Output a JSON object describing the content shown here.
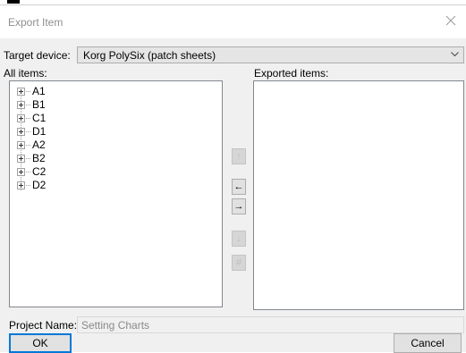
{
  "dialog": {
    "title": "Export Item",
    "close_icon": "close-icon"
  },
  "target_device": {
    "label": "Target device:",
    "value": "Korg PolySix (patch sheets)",
    "icon": "chevron-down-icon"
  },
  "all_items": {
    "label": "All items:",
    "items": [
      "A1",
      "B1",
      "C1",
      "D1",
      "A2",
      "B2",
      "C2",
      "D2"
    ]
  },
  "exported_items": {
    "label": "Exported items:",
    "items": []
  },
  "transfer_buttons": {
    "move_up": "↑",
    "remove": "←",
    "add": "→",
    "move_down": "↓",
    "renumber": "#"
  },
  "project": {
    "label": "Project Name:",
    "value": "Setting Charts"
  },
  "footer": {
    "ok_label": "OK",
    "cancel_label": "Cancel"
  }
}
